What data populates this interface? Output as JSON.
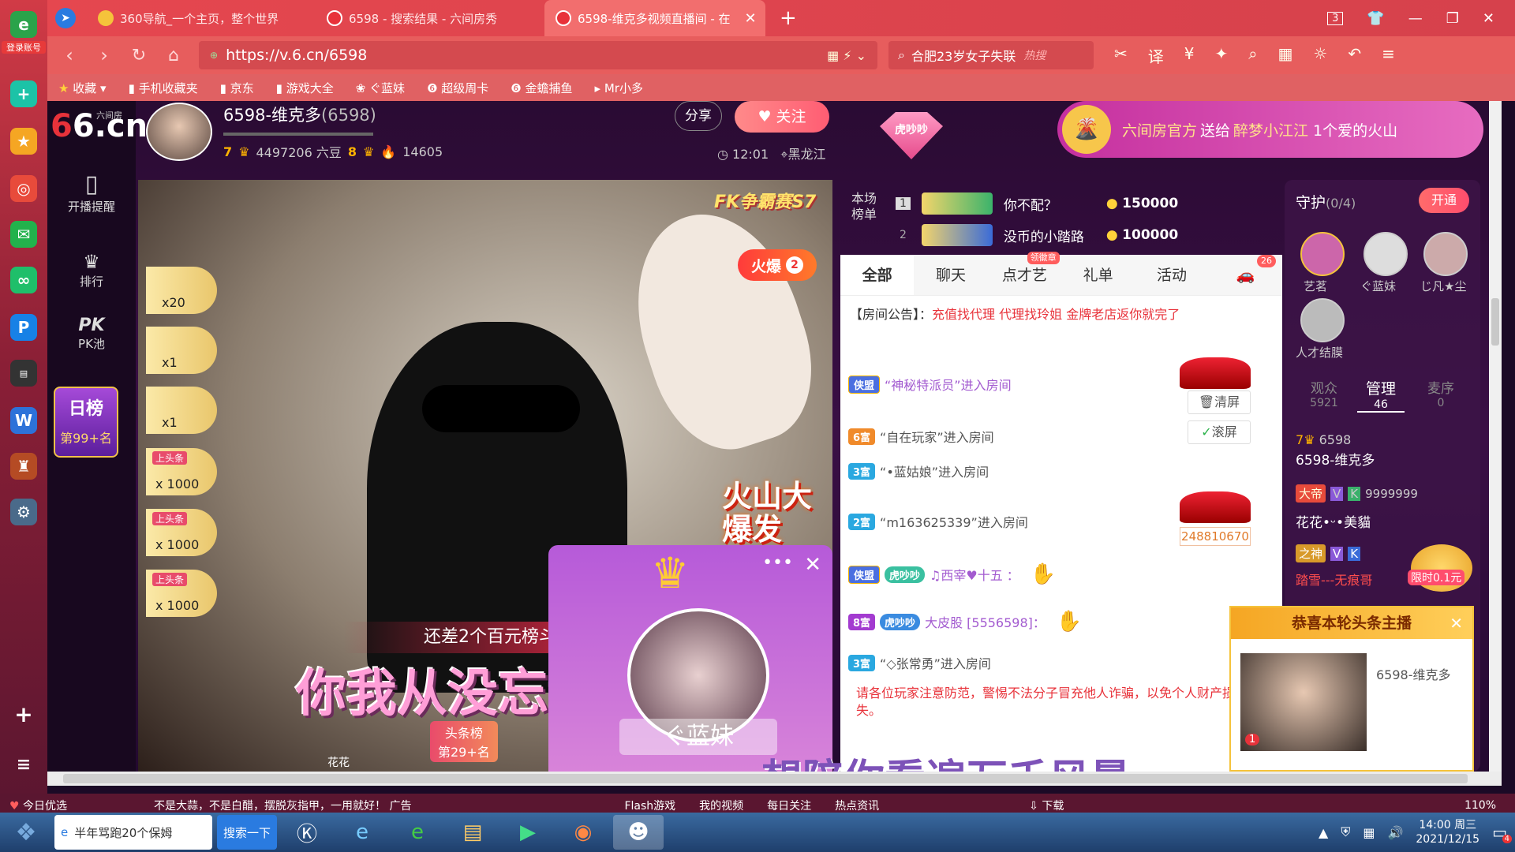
{
  "browser": {
    "tabs": [
      {
        "label": "360导航_一个主页，整个世界",
        "active": false
      },
      {
        "label": "6598 - 搜索结果 - 六间房秀",
        "active": false
      },
      {
        "label": "6598-维克多视频直播间 - 在",
        "active": true
      }
    ],
    "tab_count": "3",
    "url": "https://v.6.cn/6598",
    "search_placeholder": "合肥23岁女子失联",
    "search_hot": "热搜",
    "bookmarks": [
      "收藏",
      "手机收藏夹",
      "京东",
      "游戏大全",
      "ぐ蓝妹",
      "超级周卡",
      "金蟾捕鱼",
      "Mr小多"
    ],
    "login_label": "登录账号"
  },
  "site": {
    "logo": "6.cn",
    "logo_sub": "六间房",
    "nav": [
      {
        "label": "开播提醒"
      },
      {
        "label": "排行"
      },
      {
        "label": "PK池"
      }
    ],
    "daily_rank": {
      "title": "日榜",
      "rank": "第99+名"
    },
    "streamer": {
      "name": "6598-维克多",
      "id": "(6598)",
      "level_a": "7",
      "beans": "4497206 六豆",
      "level_b": "8",
      "fire": "14605",
      "share": "分享",
      "follow": "关注",
      "time": "12:01",
      "location": "黑龙江"
    },
    "banner": {
      "prefix": "六间房官方",
      "action": "送给",
      "user": "醉梦小江江",
      "gift": "1个爱的火山"
    },
    "video": {
      "event_label": "FK争霸赛S7",
      "hot_label": "火爆",
      "hot_count": "2",
      "volcano_text": "火山大爆发",
      "need_text": "还差2个百元榜斗",
      "subtitle_top": "你我从没忘记",
      "subtitle_bottom": "想陪你看遍万千风景",
      "gifts": [
        "x20",
        "x1",
        "x1",
        "x 1000",
        "x 1000",
        "x 1000"
      ],
      "toutiao": "上头条",
      "popup_name": "ぐ蓝妹",
      "bottom_badge": "头条榜",
      "bottom_rank": "第29+名",
      "bottom_user": "花花"
    },
    "ranking": {
      "label": "本场榜单",
      "rows": [
        {
          "rank": "1",
          "name": "你不配？",
          "coins": "150000"
        },
        {
          "rank": "2",
          "name": "没币的小踏路",
          "coins": "100000"
        }
      ]
    },
    "chat": {
      "tabs": [
        "全部",
        "聊天",
        "点才艺",
        "礼单",
        "活动"
      ],
      "tab_badge": "领徽章",
      "car_count": "26",
      "notice_label": "【房间公告】：",
      "notice_text": "充值找代理 代理找玲姐 金牌老店返你就完了",
      "messages": [
        {
          "badge": "侠盟",
          "text": "“神秘特派员”进入房间"
        },
        {
          "badge": "6富",
          "text": "“自在玩家”进入房间"
        },
        {
          "badge": "3富",
          "text": "“•蓝姑娘”进入房间"
        },
        {
          "badge": "2富",
          "text": "“m163625339”进入房间"
        },
        {
          "badge": "侠盟",
          "text": "♫西宰♥十五 ："
        },
        {
          "badge": "8富",
          "text": "大皮股 [5556598]："
        },
        {
          "badge": "3富",
          "text": "“◇张常勇”进入房间"
        }
      ],
      "clear_btn": "清屏",
      "scroll_btn": "滚屏",
      "car_value": "248810670",
      "huchao": "虎吵吵",
      "warning": "请各位玩家注意防范，警惕不法分子冒充他人诈骗，以免个人财产损失。"
    },
    "guard": {
      "title": "守护",
      "count": "(0/4)",
      "open_btn": "开通",
      "members": [
        "艺茗",
        "ぐ蓝妹",
        "じ凡★尘",
        "人才结膜"
      ],
      "tabs": [
        {
          "label": "观众",
          "value": "5921"
        },
        {
          "label": "管理",
          "value": "46"
        },
        {
          "label": "麦序",
          "value": "0"
        }
      ],
      "list": [
        {
          "level": "7",
          "id": "6598",
          "name": "6598-维克多"
        },
        {
          "level": "大帝",
          "id": "9999999",
          "name": "花花•ᵕ•美貓"
        },
        {
          "level": "之神",
          "id": "",
          "name": "踏雪---无痕哥"
        }
      ],
      "limit_label": "限时0.1元"
    },
    "congrats": {
      "title": "恭喜本轮头条主播",
      "name": "6598-维克多",
      "badge": "1"
    }
  },
  "statusbar": {
    "items": [
      "今日优选",
      "不是大蒜，不是白醋，摆脱灰指甲，一用就好！",
      "广告",
      "Flash游戏",
      "我的视频",
      "每日关注",
      "热点资讯",
      "下载",
      "110%"
    ]
  },
  "taskbar": {
    "app_label": "半年骂跑20个保姆",
    "search_btn": "搜索一下",
    "time": "14:00 周三",
    "date": "2021/12/15",
    "notif": "4"
  }
}
